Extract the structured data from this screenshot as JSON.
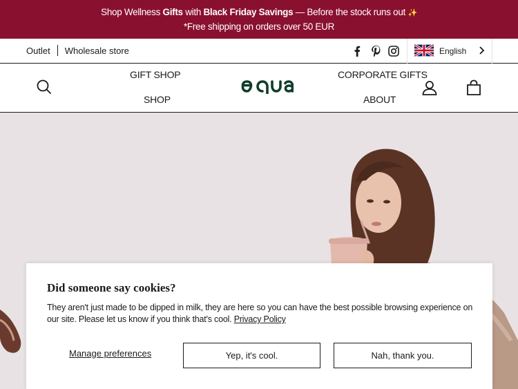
{
  "announcement": {
    "line1_pre": "Shop Wellness ",
    "line1_bold1": "Gifts",
    "line1_mid": " with ",
    "line1_bold2": "Black Friday Savings",
    "line1_post": " — Before the stock runs out ",
    "line1_emoji": "✨",
    "line2": "*Free shipping on orders over 50 EUR",
    "color": "#8a1030"
  },
  "utility": {
    "outlet": "Outlet",
    "wholesale": "Wholesale store",
    "social_icons": [
      "facebook-icon",
      "pinterest-icon",
      "instagram-icon"
    ],
    "language": "English",
    "flag": "uk-flag-icon"
  },
  "nav": {
    "gift_shop": "GIFT SHOP",
    "shop": "SHOP",
    "corporate_gifts": "CORPORATE GIFTS",
    "about": "ABOUT",
    "logo_alt": "equa",
    "icons": [
      "search-icon",
      "account-icon",
      "cart-icon"
    ]
  },
  "cookie": {
    "title": "Did someone say cookies?",
    "body": "They aren't just made to be dipped in milk, they are here so you can have the best possible browsing experience on our site. Please let us know if you think that's cool. ",
    "policy_link": "Privacy Policy",
    "manage": "Manage preferences",
    "accept": "Yep, it's cool.",
    "decline": "Nah, thank you."
  }
}
